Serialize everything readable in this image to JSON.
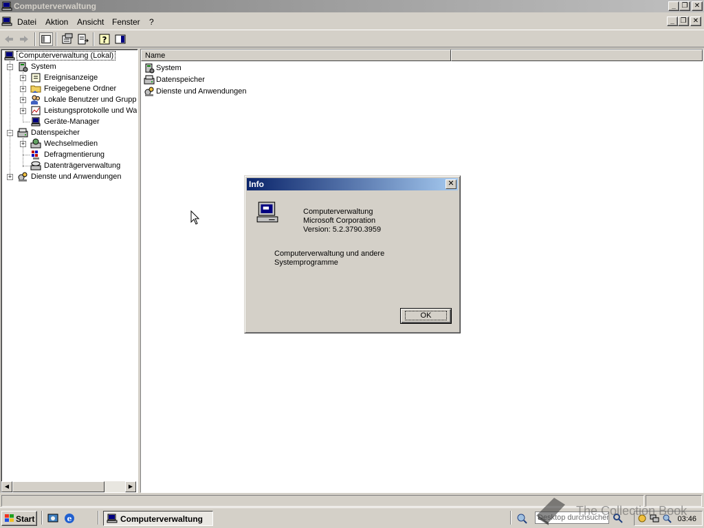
{
  "window": {
    "title": "Computerverwaltung"
  },
  "menu": {
    "items": [
      {
        "label": "Datei"
      },
      {
        "label": "Aktion"
      },
      {
        "label": "Ansicht"
      },
      {
        "label": "Fenster"
      },
      {
        "label": "?"
      }
    ]
  },
  "toolbar": {
    "icons": [
      "back-arrow-icon",
      "forward-arrow-icon",
      "show-hide-tree-icon",
      "properties-icon",
      "export-list-icon",
      "help-icon",
      "action-pane-icon"
    ]
  },
  "tree": {
    "root": "Computerverwaltung (Lokal)",
    "system": "System",
    "system_children": [
      "Ereignisanzeige",
      "Freigegebene Ordner",
      "Lokale Benutzer und Gruppen",
      "Leistungsprotokolle und Warnungen",
      "Geräte-Manager"
    ],
    "storage": "Datenspeicher",
    "storage_children": [
      "Wechselmedien",
      "Defragmentierung",
      "Datenträgerverwaltung"
    ],
    "services": "Dienste und Anwendungen"
  },
  "list": {
    "column_name": "Name",
    "items": [
      "System",
      "Datenspeicher",
      "Dienste und Anwendungen"
    ]
  },
  "dialog": {
    "title": "Info",
    "product": "Computerverwaltung",
    "company": "Microsoft Corporation",
    "version": "Version: 5.2.3790.3959",
    "description_line1": "Computerverwaltung und andere",
    "description_line2": "Systemprogramme",
    "ok_label": "OK"
  },
  "taskbar": {
    "start_label": "Start",
    "task_label": "Computerverwaltung",
    "search_placeholder": "Desktop durchsuchen",
    "clock": "03:46"
  },
  "watermark": "The Collection Book",
  "colors": {
    "title_active_start": "#0a246a",
    "title_active_end": "#a6caf0",
    "title_inactive_start": "#808080",
    "face": "#d4d0c8"
  }
}
